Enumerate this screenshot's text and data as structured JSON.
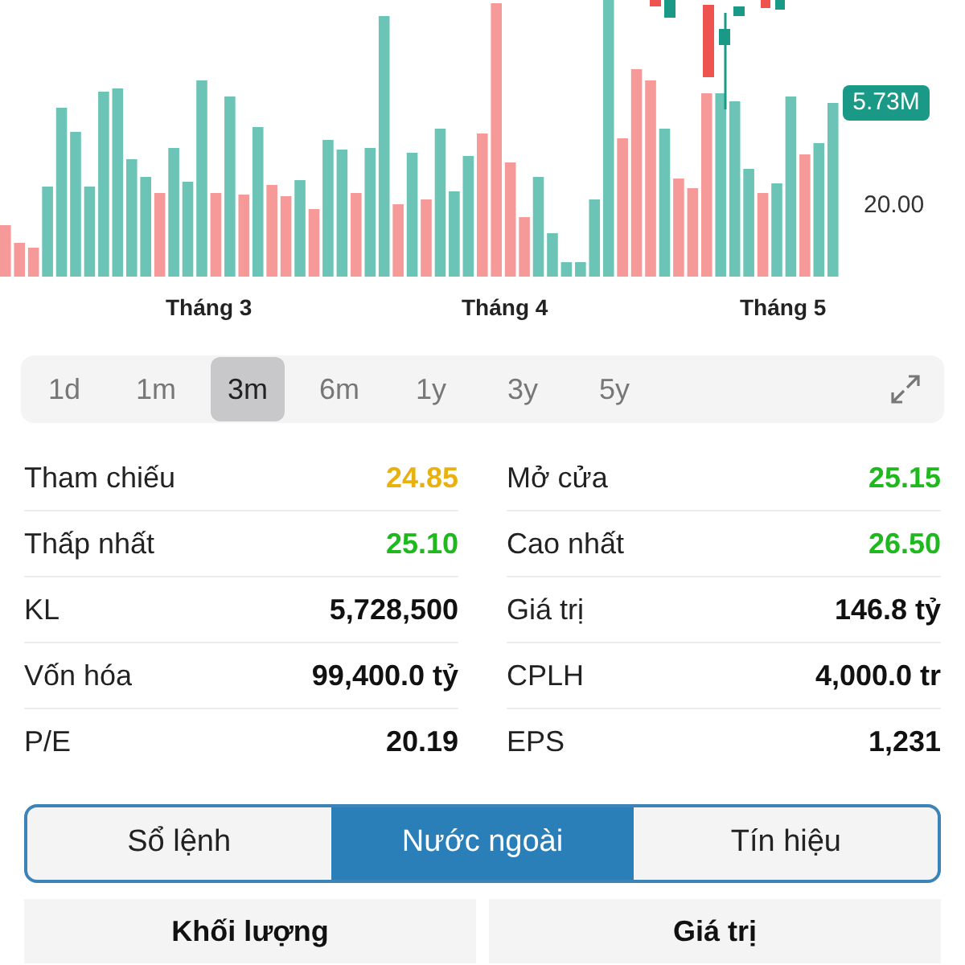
{
  "chart": {
    "x_labels": [
      "Tháng 3",
      "Tháng 4",
      "Tháng 5"
    ],
    "price_tick": "20.00",
    "volume_badge": "5.73M"
  },
  "periods": [
    {
      "label": "1d",
      "selected": false
    },
    {
      "label": "1m",
      "selected": false
    },
    {
      "label": "3m",
      "selected": true
    },
    {
      "label": "6m",
      "selected": false
    },
    {
      "label": "1y",
      "selected": false
    },
    {
      "label": "3y",
      "selected": false
    },
    {
      "label": "5y",
      "selected": false
    }
  ],
  "stats": [
    [
      {
        "label": "Tham chiếu",
        "value": "24.85",
        "color": "#e9b10e"
      },
      {
        "label": "Mở cửa",
        "value": "25.15",
        "color": "#1fb81f"
      }
    ],
    [
      {
        "label": "Thấp nhất",
        "value": "25.10",
        "color": "#1fb81f"
      },
      {
        "label": "Cao nhất",
        "value": "26.50",
        "color": "#1fb81f"
      }
    ],
    [
      {
        "label": "KL",
        "value": "5,728,500",
        "color": "#111111"
      },
      {
        "label": "Giá trị",
        "value": "146.8 tỷ",
        "color": "#111111"
      }
    ],
    [
      {
        "label": "Vốn hóa",
        "value": "99,400.0 tỷ",
        "color": "#111111"
      },
      {
        "label": "CPLH",
        "value": "4,000.0 tr",
        "color": "#111111"
      }
    ],
    [
      {
        "label": "P/E",
        "value": "20.19",
        "color": "#111111"
      },
      {
        "label": "EPS",
        "value": "1,231",
        "color": "#111111"
      }
    ]
  ],
  "segments": [
    {
      "label": "Sổ lệnh",
      "selected": false
    },
    {
      "label": "Nước ngoài",
      "selected": true
    },
    {
      "label": "Tín hiệu",
      "selected": false
    }
  ],
  "table_header": [
    "Khối lượng",
    "Giá trị"
  ]
}
